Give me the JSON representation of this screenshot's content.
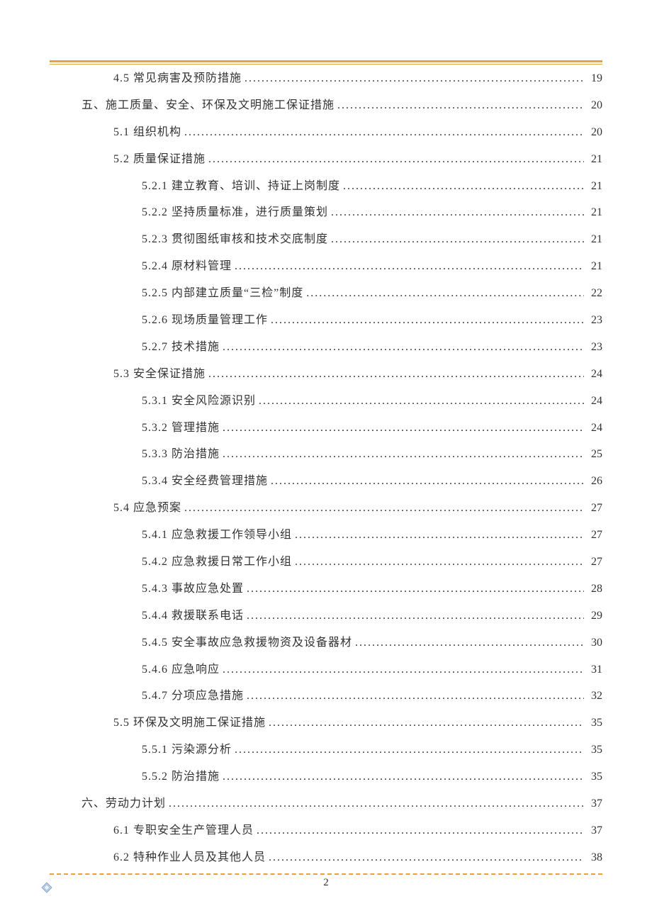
{
  "page_number": "2",
  "toc": [
    {
      "level": 1,
      "label": "4.5 常见病害及预防措施",
      "page": "19"
    },
    {
      "level": 0,
      "label": "五、施工质量、安全、环保及文明施工保证措施",
      "page": "20"
    },
    {
      "level": 1,
      "label": "5.1 组织机构",
      "page": "20"
    },
    {
      "level": 1,
      "label": "5.2 质量保证措施",
      "page": "21"
    },
    {
      "level": 2,
      "label": "5.2.1 建立教育、培训、持证上岗制度",
      "page": "21"
    },
    {
      "level": 2,
      "label": "5.2.2 坚持质量标准，进行质量策划",
      "page": "21"
    },
    {
      "level": 2,
      "label": "5.2.3 贯彻图纸审核和技术交底制度",
      "page": "21"
    },
    {
      "level": 2,
      "label": "5.2.4 原材料管理",
      "page": "21"
    },
    {
      "level": 2,
      "label": "5.2.5 内部建立质量“三检”制度",
      "page": "22"
    },
    {
      "level": 2,
      "label": "5.2.6 现场质量管理工作",
      "page": "23"
    },
    {
      "level": 2,
      "label": "5.2.7 技术措施",
      "page": "23"
    },
    {
      "level": 1,
      "label": "5.3 安全保证措施",
      "page": "24"
    },
    {
      "level": 2,
      "label": "5.3.1 安全风险源识别",
      "page": "24"
    },
    {
      "level": 2,
      "label": "5.3.2 管理措施",
      "page": "24"
    },
    {
      "level": 2,
      "label": "5.3.3 防治措施",
      "page": "25"
    },
    {
      "level": 2,
      "label": "5.3.4 安全经费管理措施",
      "page": "26"
    },
    {
      "level": 1,
      "label": "5.4 应急预案",
      "page": "27"
    },
    {
      "level": 2,
      "label": "5.4.1 应急救援工作领导小组",
      "page": "27"
    },
    {
      "level": 2,
      "label": "5.4.2 应急救援日常工作小组",
      "page": "27"
    },
    {
      "level": 2,
      "label": "5.4.3 事故应急处置",
      "page": "28"
    },
    {
      "level": 2,
      "label": "5.4.4 救援联系电话",
      "page": "29"
    },
    {
      "level": 2,
      "label": "5.4.5 安全事故应急救援物资及设备器材",
      "page": "30"
    },
    {
      "level": 2,
      "label": "5.4.6  应急响应",
      "page": "31"
    },
    {
      "level": 2,
      "label": "5.4.7  分项应急措施",
      "page": "32"
    },
    {
      "level": 1,
      "label": "5.5 环保及文明施工保证措施",
      "page": "35"
    },
    {
      "level": 2,
      "label": "5.5.1 污染源分析",
      "page": "35"
    },
    {
      "level": 2,
      "label": "5.5.2 防治措施",
      "page": "35"
    },
    {
      "level": 0,
      "label": "六、劳动力计划",
      "page": "37"
    },
    {
      "level": 1,
      "label": "6.1 专职安全生产管理人员",
      "page": "37"
    },
    {
      "level": 1,
      "label": "6.2 特种作业人员及其他人员",
      "page": "38"
    }
  ]
}
